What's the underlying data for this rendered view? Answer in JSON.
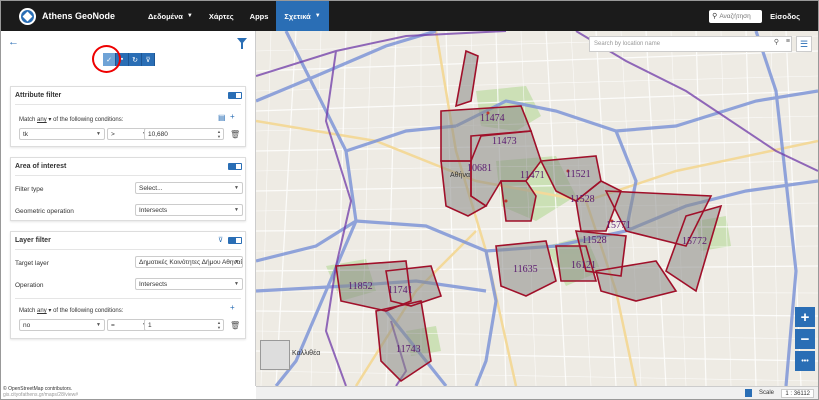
{
  "navbar": {
    "brand": "Athens GeoNode",
    "items": [
      {
        "label": "Δεδομένα",
        "caret": true
      },
      {
        "label": "Χάρτες",
        "caret": false
      },
      {
        "label": "Apps",
        "caret": false
      },
      {
        "label": "Σχετικά",
        "caret": true
      }
    ],
    "search_placeholder": "Αναζήτηση",
    "login": "Είσοδος"
  },
  "panel": {
    "attribute_filter": {
      "title": "Attribute filter",
      "match_prefix": "Match",
      "match_any": "any",
      "match_suffix": "of the following conditions:",
      "field": "tk",
      "operator": ">",
      "value": "10,680"
    },
    "area_of_interest": {
      "title": "Area of interest",
      "filter_type_label": "Filter type",
      "filter_type_value": "Select...",
      "geom_op_label": "Geometric operation",
      "geom_op_value": "Intersects"
    },
    "layer_filter": {
      "title": "Layer filter",
      "target_label": "Target layer",
      "target_value": "Δημοτικές Κοινότητες Δήμου Αθηναί",
      "operation_label": "Operation",
      "operation_value": "Intersects",
      "match_prefix": "Match",
      "match_any": "any",
      "match_suffix": "of the following conditions:",
      "field": "no",
      "operator": "=",
      "value": "1"
    }
  },
  "map": {
    "search_placeholder": "Search by location name",
    "city_label": "Αθήνα",
    "minimap_label": "Καλλιθέα",
    "polygon_labels": [
      "11474",
      "11473",
      "10681",
      "11471",
      "11521",
      "11528",
      "15771",
      "11528",
      "15772",
      "11635",
      "16121",
      "11852",
      "11741",
      "11743"
    ],
    "zoom_in": "+",
    "zoom_out": "−",
    "more": "•••"
  },
  "footer": {
    "attribution": "© OpenStreetMap contributors.",
    "url": "gis.cityofathens.gr/maps/28/view#",
    "scale_label": "Scale",
    "scale_value": "1 : 36112"
  },
  "colors": {
    "primary": "#2a6eb5",
    "navbar": "#1b1b1b",
    "highlight": "#e00000",
    "polygon": "#a0102a"
  }
}
